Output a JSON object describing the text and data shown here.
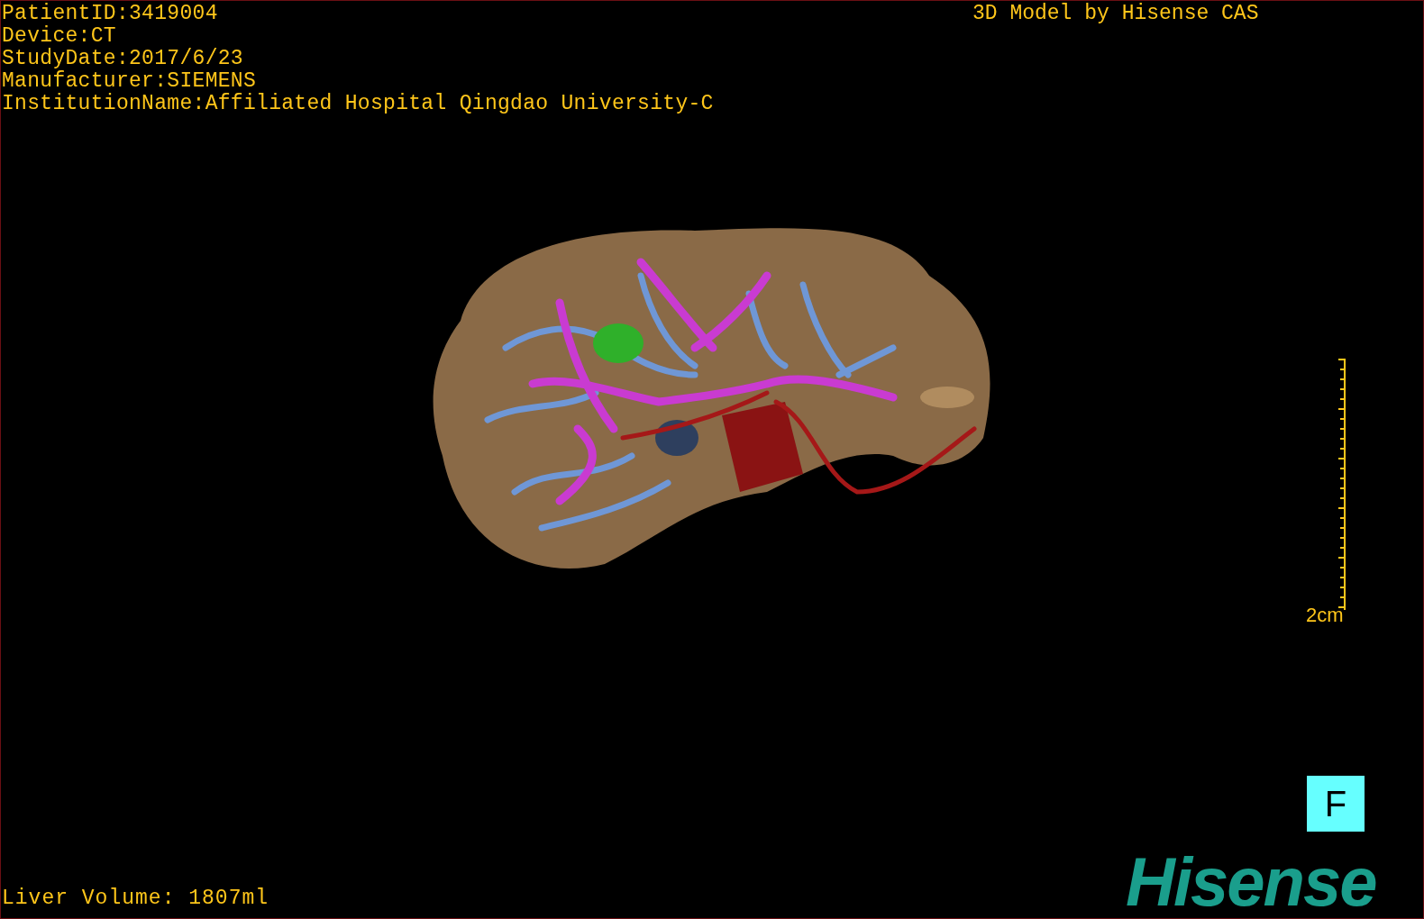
{
  "study_info": [
    "PatientID:3419004",
    "Device:CT",
    "StudyDate:2017/6/23",
    "Manufacturer:SIEMENS",
    "InstitutionName:Affiliated Hospital Qingdao University-C"
  ],
  "model_credit": "3D Model by Hisense CAS",
  "scale_bar": {
    "label": "2cm"
  },
  "orientation_marker": "F",
  "liver_volume": "Liver Volume: 1807ml",
  "logo": "Hisense"
}
